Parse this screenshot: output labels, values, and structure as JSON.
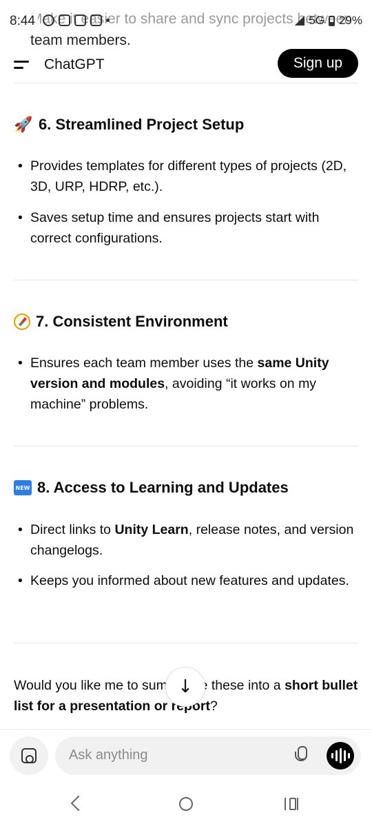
{
  "status_bar": {
    "time": "8:44",
    "network": "5G",
    "battery": "29%",
    "overlay_text": "Make it easier to share and sync projects between",
    "overlay_text_line2": "team members."
  },
  "header": {
    "app_title": "ChatGPT",
    "signup_label": "Sign up"
  },
  "sections": [
    {
      "icon": "rocket-icon",
      "title": "6. Streamlined Project Setup",
      "bullets": [
        {
          "text": "Provides templates for different types of projects (2D, 3D, URP, HDRP, etc.)."
        },
        {
          "text": "Saves setup time and ensures projects start with correct configurations."
        }
      ]
    },
    {
      "icon": "compass-icon",
      "title": "7. Consistent Environment",
      "bullets": [
        {
          "pre": "Ensures each team member uses the ",
          "bold": "same Unity version and modules",
          "post": ", avoiding “it works on my machine” problems."
        }
      ]
    },
    {
      "icon": "new-badge-icon",
      "badge_text": "NEW",
      "title": "8. Access to Learning and Updates",
      "bullets": [
        {
          "pre": "Direct links to ",
          "bold": "Unity Learn",
          "post": ", release notes, and version changelogs."
        },
        {
          "text": "Keeps you informed about new features and updates."
        }
      ]
    }
  ],
  "closing": {
    "pre": "Would you like me to summarize these into a ",
    "bold": "short bullet list for a presentation or report",
    "post": "?"
  },
  "composer": {
    "placeholder": "Ask anything"
  }
}
